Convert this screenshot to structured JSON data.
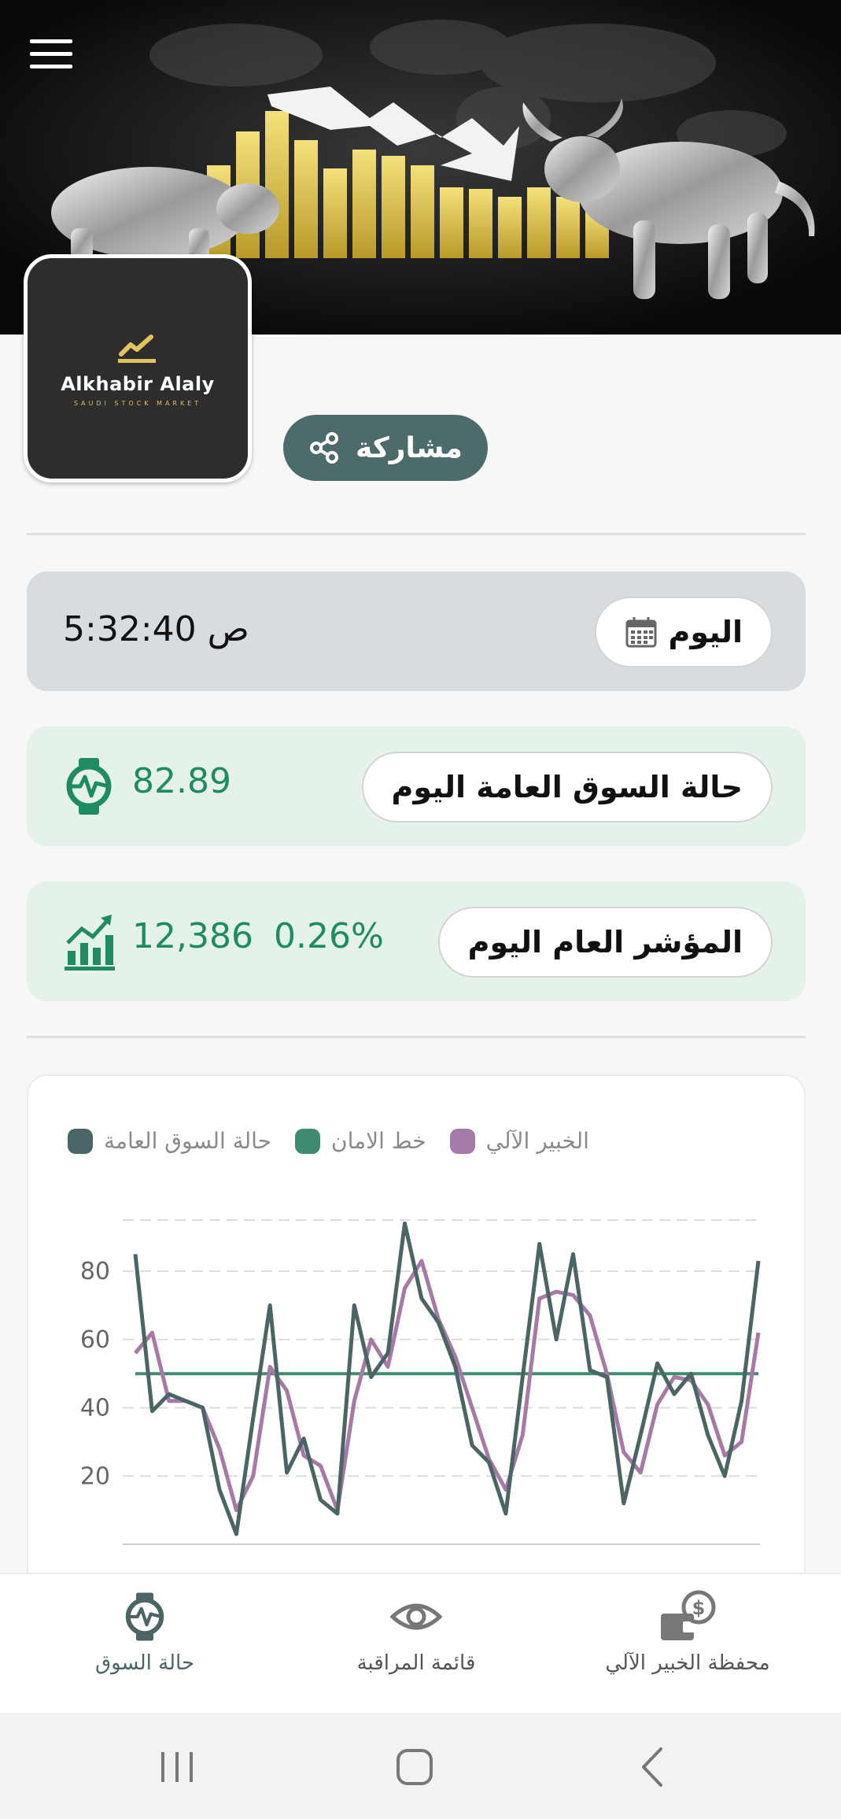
{
  "header": {
    "menu_icon": "hamburger-menu-icon",
    "banner_description_icon": "bull-bear-market-graphic"
  },
  "logo": {
    "brand": "Alkhabir Alaly",
    "tagline": "SAUDI STOCK MARKET",
    "accent_color": "#d9c070"
  },
  "share": {
    "label": "مشاركة",
    "icon": "share-icon"
  },
  "time_card": {
    "day_label": "اليوم",
    "time": "5:32:40",
    "am_pm": "ص",
    "icon": "calendar-icon"
  },
  "market_status_card": {
    "label": "حالة السوق العامة اليوم",
    "value": "82.89",
    "icon": "market-pulse-icon"
  },
  "index_card": {
    "label": "المؤشر العام اليوم",
    "value": "12,386",
    "change": "0.26%",
    "icon": "bar-growth-icon"
  },
  "colors": {
    "primary": "#4d6b6b",
    "green": "#1f8b63",
    "market_line": "#4b6565",
    "safety_line": "#3f8a72",
    "expert_line": "#a57aa6"
  },
  "chart_data": {
    "type": "line",
    "legend": [
      "الخبير الآلي",
      "خط الامان",
      "حالة السوق العامة"
    ],
    "y_ticks": [
      "80",
      "60",
      "40",
      "20"
    ],
    "ylim": [
      0,
      95
    ],
    "grid": true,
    "legend_position": "top",
    "series": [
      {
        "name": "حالة السوق العامة",
        "values": [
          85,
          39,
          44,
          42,
          40,
          16,
          3,
          37,
          70,
          21,
          31,
          13,
          9,
          70,
          49,
          56,
          94,
          72,
          65,
          52,
          29,
          24,
          9,
          49,
          88,
          60,
          85,
          51,
          49,
          12,
          32,
          53,
          44,
          50,
          32,
          20,
          42,
          83
        ]
      },
      {
        "name": "خط الامان",
        "values": [
          50,
          50,
          50,
          50,
          50,
          50,
          50,
          50,
          50,
          50,
          50,
          50,
          50,
          50,
          50,
          50,
          50,
          50,
          50,
          50,
          50,
          50,
          50,
          50,
          50,
          50,
          50,
          50,
          50,
          50,
          50,
          50,
          50,
          50,
          50,
          50,
          50,
          50
        ]
      },
      {
        "name": "الخبير الآلي",
        "values": [
          56,
          62,
          42,
          42,
          40,
          28,
          10,
          20,
          52,
          45,
          26,
          23,
          10,
          42,
          60,
          52,
          75,
          83,
          66,
          55,
          40,
          25,
          16,
          32,
          72,
          74,
          73,
          67,
          50,
          27,
          21,
          41,
          49,
          48,
          41,
          26,
          30,
          62
        ]
      }
    ]
  },
  "bottom_nav": {
    "items": [
      {
        "label": "حالة السوق",
        "icon": "market-pulse-icon"
      },
      {
        "label": "قائمة المراقبة",
        "icon": "eye-icon"
      },
      {
        "label": "محفظة الخبير الآلي",
        "icon": "wallet-dollar-icon"
      }
    ]
  },
  "system_nav": {
    "recents": "recents-icon",
    "home": "home-icon",
    "back": "back-icon"
  }
}
